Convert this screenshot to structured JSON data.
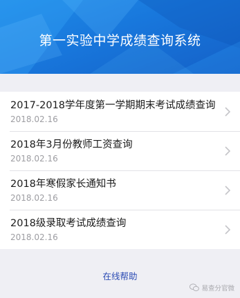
{
  "header": {
    "title": "第一实验中学成绩查询系统"
  },
  "items": [
    {
      "title": "2017-2018学年度第一学期期末考试成绩查询",
      "date": "2018.02.16"
    },
    {
      "title": "2018年3月份教师工资查询",
      "date": "2018.02.16"
    },
    {
      "title": "2018年寒假家长通知书",
      "date": "2018.02.16"
    },
    {
      "title": "2018级录取考试成绩查询",
      "date": "2018.02.16"
    }
  ],
  "footer": {
    "help_label": "在线帮助"
  },
  "watermark": {
    "text": "易查分官微",
    "icon": "wechat-icon"
  },
  "colors": {
    "banner": "#1877dc",
    "link": "#2a4ab3",
    "background": "#efeff4"
  }
}
